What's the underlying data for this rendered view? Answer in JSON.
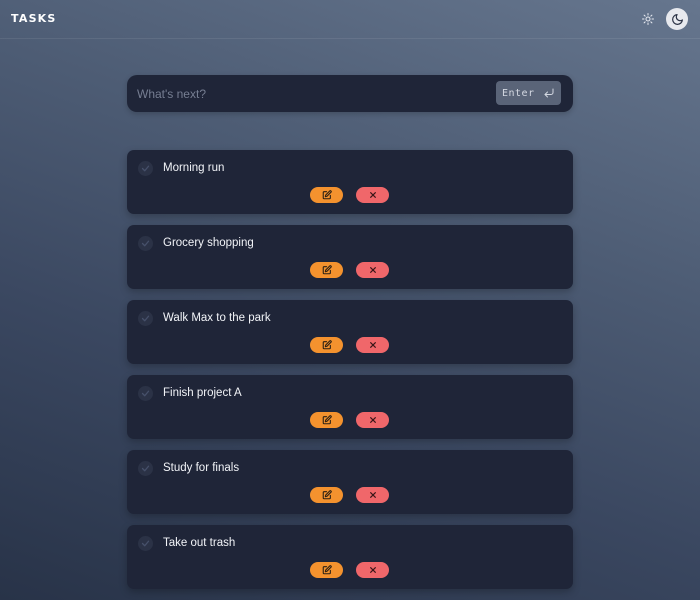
{
  "header": {
    "title": "TASKS",
    "light_theme_icon": "sun-icon",
    "dark_theme_icon": "moon-icon"
  },
  "input": {
    "placeholder": "What's next?",
    "value": "",
    "enter_label": "Enter",
    "enter_icon": "return-arrow-icon"
  },
  "tasks": [
    {
      "title": "Morning run"
    },
    {
      "title": "Grocery shopping"
    },
    {
      "title": "Walk Max to the park"
    },
    {
      "title": "Finish project A"
    },
    {
      "title": "Study for finals"
    },
    {
      "title": "Take out trash"
    }
  ],
  "colors": {
    "card": "#1f2538",
    "edit": "#f4922e",
    "delete": "#f0676a"
  }
}
